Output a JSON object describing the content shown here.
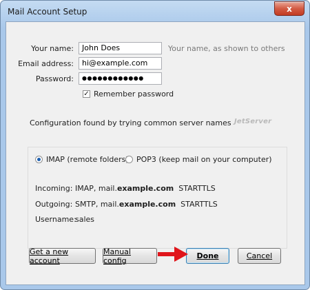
{
  "window": {
    "title": "Mail Account Setup",
    "close_glyph": "x"
  },
  "form": {
    "name_label": "Your name:",
    "name_value": "John Does",
    "name_hint": "Your name, as shown to others",
    "email_label": "Email address:",
    "email_value": "hi@example.com",
    "password_label": "Password:",
    "password_value": "●●●●●●●●●●●●",
    "remember_label": "Remember password",
    "remember_checked": true
  },
  "status": {
    "message": "Configuration found by trying common server names",
    "watermark": "JetServer"
  },
  "protocol": {
    "imap_label": "IMAP (remote folders)",
    "pop3_label": "POP3 (keep mail on your computer)",
    "selected": "imap"
  },
  "details": {
    "incoming_label": "Incoming:",
    "incoming_prefix": "IMAP, mail.",
    "incoming_domain": "example.com",
    "incoming_security": "STARTTLS",
    "outgoing_label": "Outgoing:",
    "outgoing_prefix": "SMTP, mail.",
    "outgoing_domain": "example.com",
    "outgoing_security": "STARTTLS",
    "username_label": "Username:",
    "username_value": "sales"
  },
  "buttons": {
    "new_account": "Get a new account",
    "manual_config": "Manual config",
    "done": "Done",
    "cancel": "Cancel"
  },
  "colors": {
    "arrow": "#e0151b",
    "radio_dot": "#1c5fb0"
  }
}
